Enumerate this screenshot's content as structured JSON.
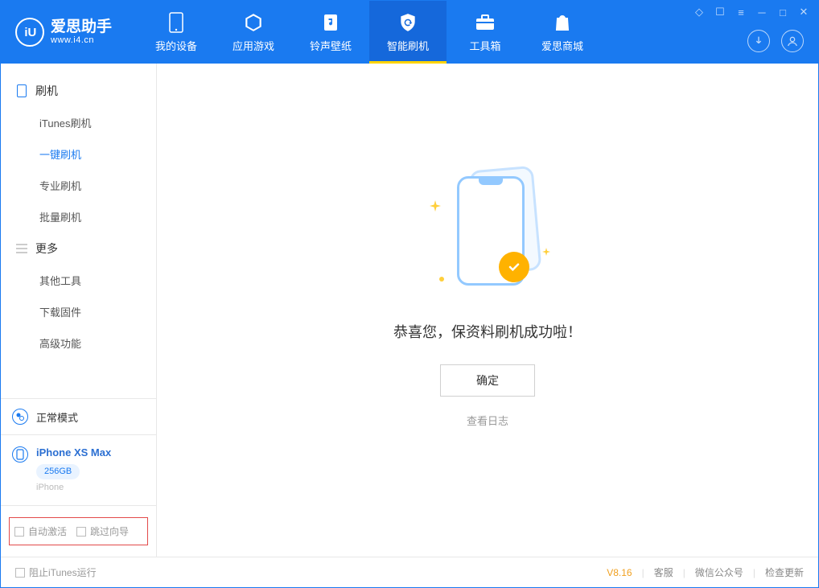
{
  "app": {
    "name": "爱思助手",
    "url": "www.i4.cn"
  },
  "nav": {
    "items": [
      {
        "key": "device",
        "label": "我的设备"
      },
      {
        "key": "apps",
        "label": "应用游戏"
      },
      {
        "key": "ring",
        "label": "铃声壁纸"
      },
      {
        "key": "flash",
        "label": "智能刷机"
      },
      {
        "key": "tools",
        "label": "工具箱"
      },
      {
        "key": "store",
        "label": "爱思商城"
      }
    ]
  },
  "sidebar": {
    "group1": {
      "title": "刷机",
      "items": [
        {
          "label": "iTunes刷机"
        },
        {
          "label": "一键刷机"
        },
        {
          "label": "专业刷机"
        },
        {
          "label": "批量刷机"
        }
      ]
    },
    "group2": {
      "title": "更多",
      "items": [
        {
          "label": "其他工具"
        },
        {
          "label": "下载固件"
        },
        {
          "label": "高级功能"
        }
      ]
    },
    "mode": "正常模式",
    "device": {
      "name": "iPhone XS Max",
      "capacity": "256GB",
      "type": "iPhone"
    },
    "checks": {
      "auto_activate": "自动激活",
      "skip_wizard": "跳过向导"
    }
  },
  "main": {
    "success": "恭喜您，保资料刷机成功啦！",
    "ok": "确定",
    "view_log": "查看日志"
  },
  "footer": {
    "block_itunes": "阻止iTunes运行",
    "version": "V8.16",
    "cs": "客服",
    "wechat": "微信公众号",
    "update": "检查更新"
  }
}
